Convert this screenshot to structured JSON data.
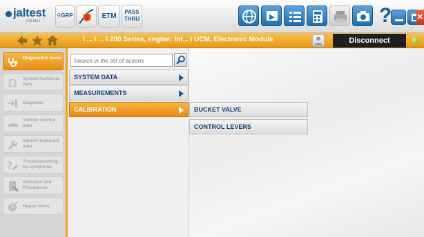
{
  "app": {
    "logo_text": "jaltest",
    "logo_subtext": "COJALI"
  },
  "toolbar": {
    "grp_label": "GRP",
    "etm_label": "ETM",
    "passthru_label_1": "PASS",
    "passthru_label_2": "THRU",
    "help_glyph": "?"
  },
  "breadcrumb": {
    "path": "\\ ... \\ ... \\ 200 Series, engine: Int...  \\ UCM, Electronic Module"
  },
  "connection": {
    "disconnect_label": "Disconnect",
    "status_color": "#7fbf1a"
  },
  "leftnav": {
    "items": [
      {
        "label": "Diagnostics menu",
        "active": true
      },
      {
        "label": "System technical data",
        "active": false
      },
      {
        "label": "Diagrams",
        "active": false
      },
      {
        "label": "Vehicle service data",
        "active": false
      },
      {
        "label": "Vehicle technical data",
        "active": false
      },
      {
        "label": "Troubleshooting by symptoms",
        "active": false
      },
      {
        "label": "Releases and Procedures",
        "active": false
      },
      {
        "label": "Repair times",
        "active": false
      }
    ]
  },
  "actions": {
    "search_placeholder": "Search in the list of actions",
    "items": [
      {
        "label": "SYSTEM DATA",
        "active": false
      },
      {
        "label": "MEASUREMENTS",
        "active": false
      },
      {
        "label": "CALIBRATION",
        "active": true
      }
    ]
  },
  "submenu": {
    "items": [
      {
        "label": "BUCKET VALVE"
      },
      {
        "label": "CONTROL LEVERS"
      }
    ]
  },
  "colors": {
    "accent_orange": "#f0a219",
    "brand_blue": "#1a5c94"
  }
}
